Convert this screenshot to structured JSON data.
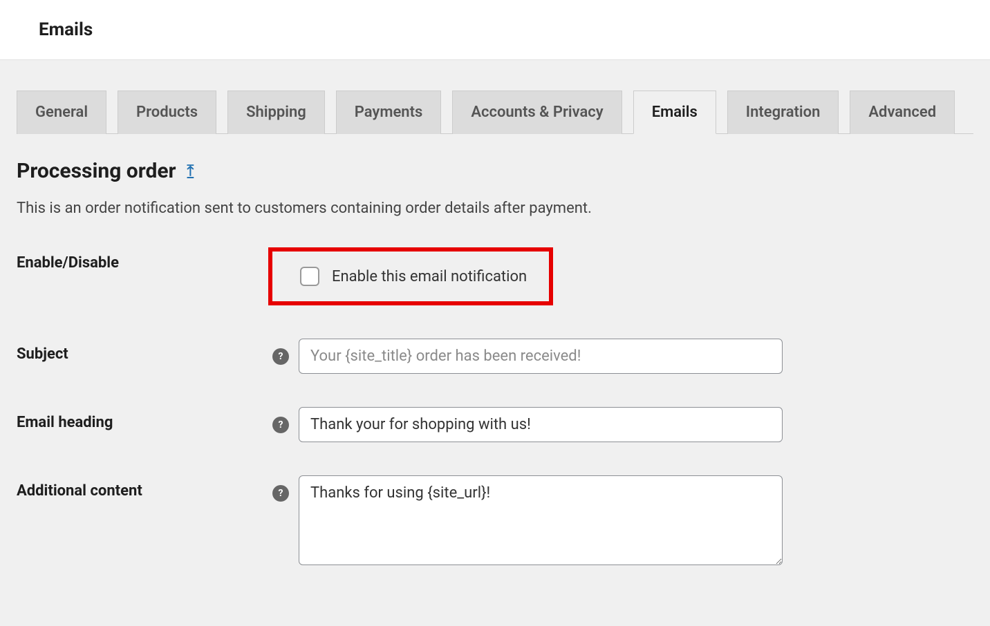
{
  "header": {
    "title": "Emails"
  },
  "tabs": [
    {
      "label": "General",
      "active": false
    },
    {
      "label": "Products",
      "active": false
    },
    {
      "label": "Shipping",
      "active": false
    },
    {
      "label": "Payments",
      "active": false
    },
    {
      "label": "Accounts & Privacy",
      "active": false
    },
    {
      "label": "Emails",
      "active": true
    },
    {
      "label": "Integration",
      "active": false
    },
    {
      "label": "Advanced",
      "active": false
    }
  ],
  "page": {
    "title": "Processing order",
    "back_icon": "⤒",
    "description": "This is an order notification sent to customers containing order details after payment."
  },
  "form": {
    "enable": {
      "label": "Enable/Disable",
      "checkbox_label": "Enable this email notification",
      "checked": false
    },
    "subject": {
      "label": "Subject",
      "value": "",
      "placeholder": "Your {site_title} order has been received!"
    },
    "heading": {
      "label": "Email heading",
      "value": "Thank your for shopping with us!"
    },
    "additional": {
      "label": "Additional content",
      "value": "Thanks for using {site_url}!"
    }
  }
}
